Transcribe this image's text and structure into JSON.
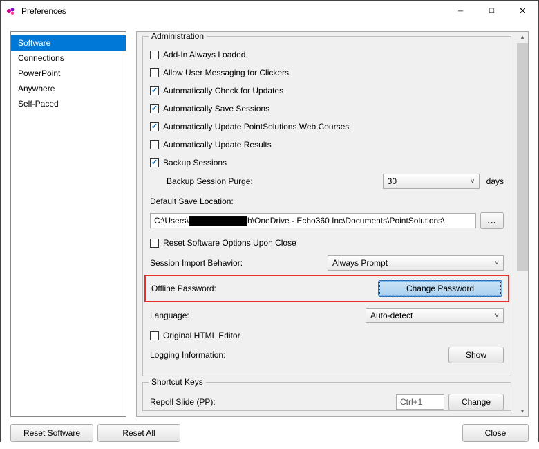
{
  "window": {
    "title": "Preferences"
  },
  "sidebar": {
    "items": [
      {
        "label": "Software"
      },
      {
        "label": "Connections"
      },
      {
        "label": "PowerPoint"
      },
      {
        "label": "Anywhere"
      },
      {
        "label": "Self-Paced"
      }
    ]
  },
  "admin": {
    "legend": "Administration",
    "addin_loaded": "Add-In Always Loaded",
    "allow_user_msg": "Allow User Messaging for Clickers",
    "auto_check_updates": "Automatically Check for Updates",
    "auto_save_sessions": "Automatically Save Sessions",
    "auto_update_web": "Automatically Update PointSolutions Web Courses",
    "auto_update_results": "Automatically Update Results",
    "backup_sessions": "Backup Sessions",
    "backup_purge_label": "Backup Session Purge:",
    "backup_purge_value": "30",
    "backup_purge_unit": "days",
    "default_save_label": "Default Save Location:",
    "default_save_path": "C:\\Users\\██████████h\\OneDrive - Echo360 Inc\\Documents\\PointSolutions\\",
    "browse_btn": "...",
    "reset_on_close": "Reset Software Options Upon Close",
    "session_import_label": "Session Import Behavior:",
    "session_import_value": "Always Prompt",
    "offline_pw_label": "Offline Password:",
    "change_pw_btn": "Change Password",
    "language_label": "Language:",
    "language_value": "Auto-detect",
    "original_html": "Original HTML Editor",
    "logging_label": "Logging Information:",
    "show_btn": "Show"
  },
  "shortcut": {
    "legend": "Shortcut Keys",
    "repoll_label": "Repoll Slide (PP):",
    "repoll_value": "Ctrl+1",
    "change_btn": "Change"
  },
  "footer": {
    "reset_software": "Reset Software",
    "reset_all": "Reset All",
    "close": "Close"
  }
}
